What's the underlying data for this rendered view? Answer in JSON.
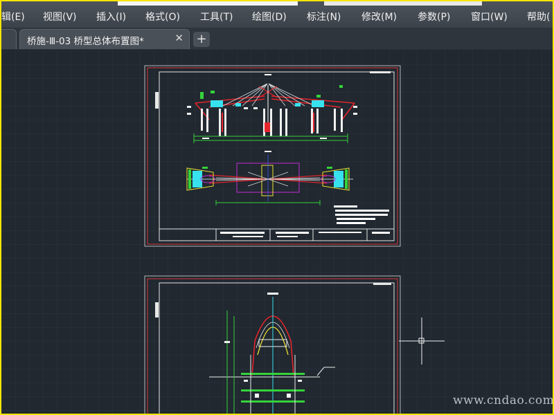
{
  "menubar": {
    "items": [
      {
        "label": "辑(E)"
      },
      {
        "label": "视图(V)"
      },
      {
        "label": "插入(I)"
      },
      {
        "label": "格式(O)"
      },
      {
        "label": "工具(T)"
      },
      {
        "label": "绘图(D)"
      },
      {
        "label": "标注(N)"
      },
      {
        "label": "修改(M)"
      },
      {
        "label": "参数(P)"
      },
      {
        "label": "窗口(W)"
      },
      {
        "label": "帮助("
      }
    ]
  },
  "tabs": {
    "active": {
      "label": "桥施-Ⅲ-03 桥型总体布置图*",
      "close_icon": "close-icon"
    },
    "new_tab_icon": "plus-icon"
  },
  "watermark": {
    "text": "www.cndao.com"
  },
  "colors": {
    "background": "#212830",
    "grid": "#2c3540",
    "border": "#c9c9c9",
    "red": "#e4252c",
    "green": "#35d33a",
    "cyan": "#38e1ee",
    "magenta": "#c42dd6",
    "yellow": "#f0e632",
    "white": "#ffffff"
  }
}
